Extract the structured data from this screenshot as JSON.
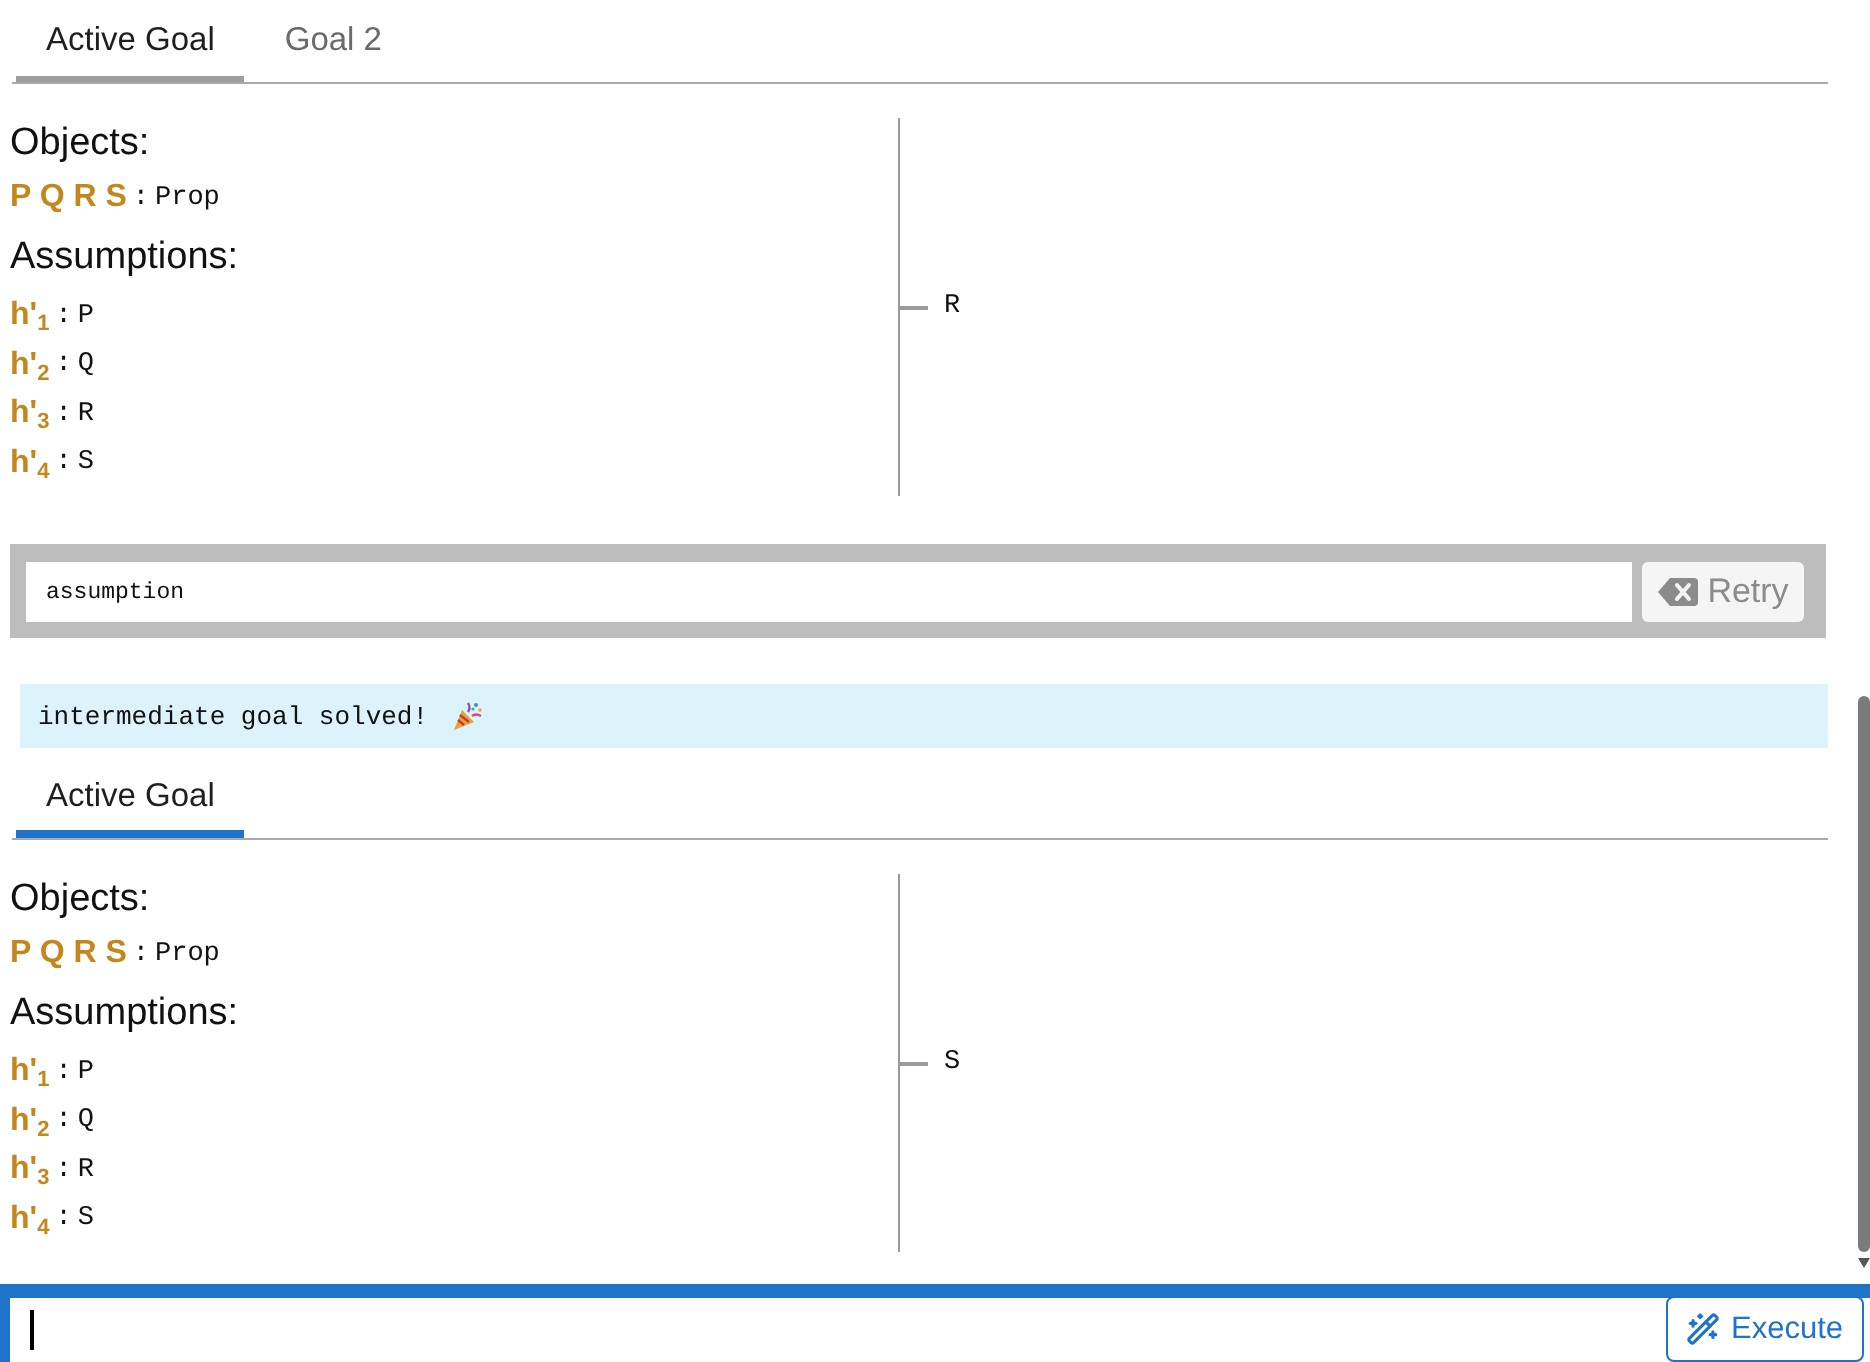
{
  "sections": [
    {
      "kind": "goal",
      "current": false,
      "tabs": [
        {
          "label": "Active Goal",
          "selected": true
        },
        {
          "label": "Goal 2",
          "selected": false
        }
      ],
      "objects": {
        "heading": "Objects:",
        "names": "P Q R S",
        "separator": ":",
        "type": "Prop"
      },
      "assumptions": {
        "heading": "Assumptions:",
        "items": [
          {
            "name": "h'$_{1}$",
            "separator": ":",
            "type": "P"
          },
          {
            "name": "h'$_{2}$",
            "separator": ":",
            "type": "Q"
          },
          {
            "name": "h'$_{3}$",
            "separator": ":",
            "type": "R"
          },
          {
            "name": "h'$_{4}$",
            "separator": ":",
            "type": "S"
          }
        ]
      },
      "target": "R"
    },
    {
      "kind": "command",
      "value": "assumption",
      "button": "Retry"
    },
    {
      "kind": "message",
      "text": "intermediate goal solved!"
    },
    {
      "kind": "goal",
      "current": true,
      "tabs": [
        {
          "label": "Active Goal",
          "selected": true
        }
      ],
      "objects": {
        "heading": "Objects:",
        "names": "P Q R S",
        "separator": ":",
        "type": "Prop"
      },
      "assumptions": {
        "heading": "Assumptions:",
        "items": [
          {
            "name": "h'$_{1}$",
            "separator": ":",
            "type": "P"
          },
          {
            "name": "h'$_{2}$",
            "separator": ":",
            "type": "Q"
          },
          {
            "name": "h'$_{3}$",
            "separator": ":",
            "type": "R"
          },
          {
            "name": "h'$_{4}$",
            "separator": ":",
            "type": "S"
          }
        ]
      },
      "target": "S"
    }
  ],
  "input": {
    "focused": true,
    "button": "Execute"
  }
}
